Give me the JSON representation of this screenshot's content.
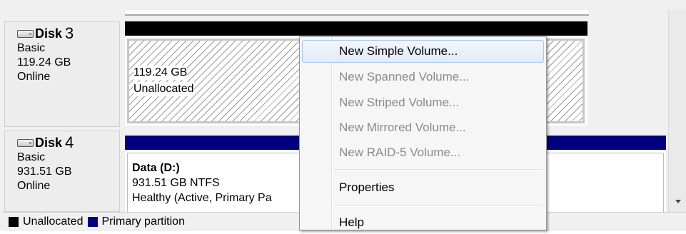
{
  "disks": [
    {
      "name": "Disk",
      "number": "3",
      "type": "Basic",
      "size": "119.24 GB",
      "status": "Online",
      "volume": {
        "size": "119.24 GB",
        "label": "Unallocated"
      }
    },
    {
      "name": "Disk",
      "number": "4",
      "type": "Basic",
      "size": "931.51 GB",
      "status": "Online",
      "volume": {
        "label": "Data  (D:)",
        "size_fs": "931.51 GB NTFS",
        "health": "Healthy (Active, Primary Pa"
      }
    }
  ],
  "legend": {
    "unallocated": "Unallocated",
    "primary": "Primary partition"
  },
  "colors": {
    "unallocated": "#000000",
    "primary": "#00007e",
    "highlight_border": "#a8c6ea"
  },
  "context_menu": {
    "items": [
      {
        "label": "New Simple Volume...",
        "enabled": true
      },
      {
        "label": "New Spanned Volume...",
        "enabled": false
      },
      {
        "label": "New Striped Volume...",
        "enabled": false
      },
      {
        "label": "New Mirrored Volume...",
        "enabled": false
      },
      {
        "label": "New RAID-5 Volume...",
        "enabled": false
      },
      {
        "label": "Properties",
        "enabled": true
      },
      {
        "label": "Help",
        "enabled": true
      }
    ]
  }
}
